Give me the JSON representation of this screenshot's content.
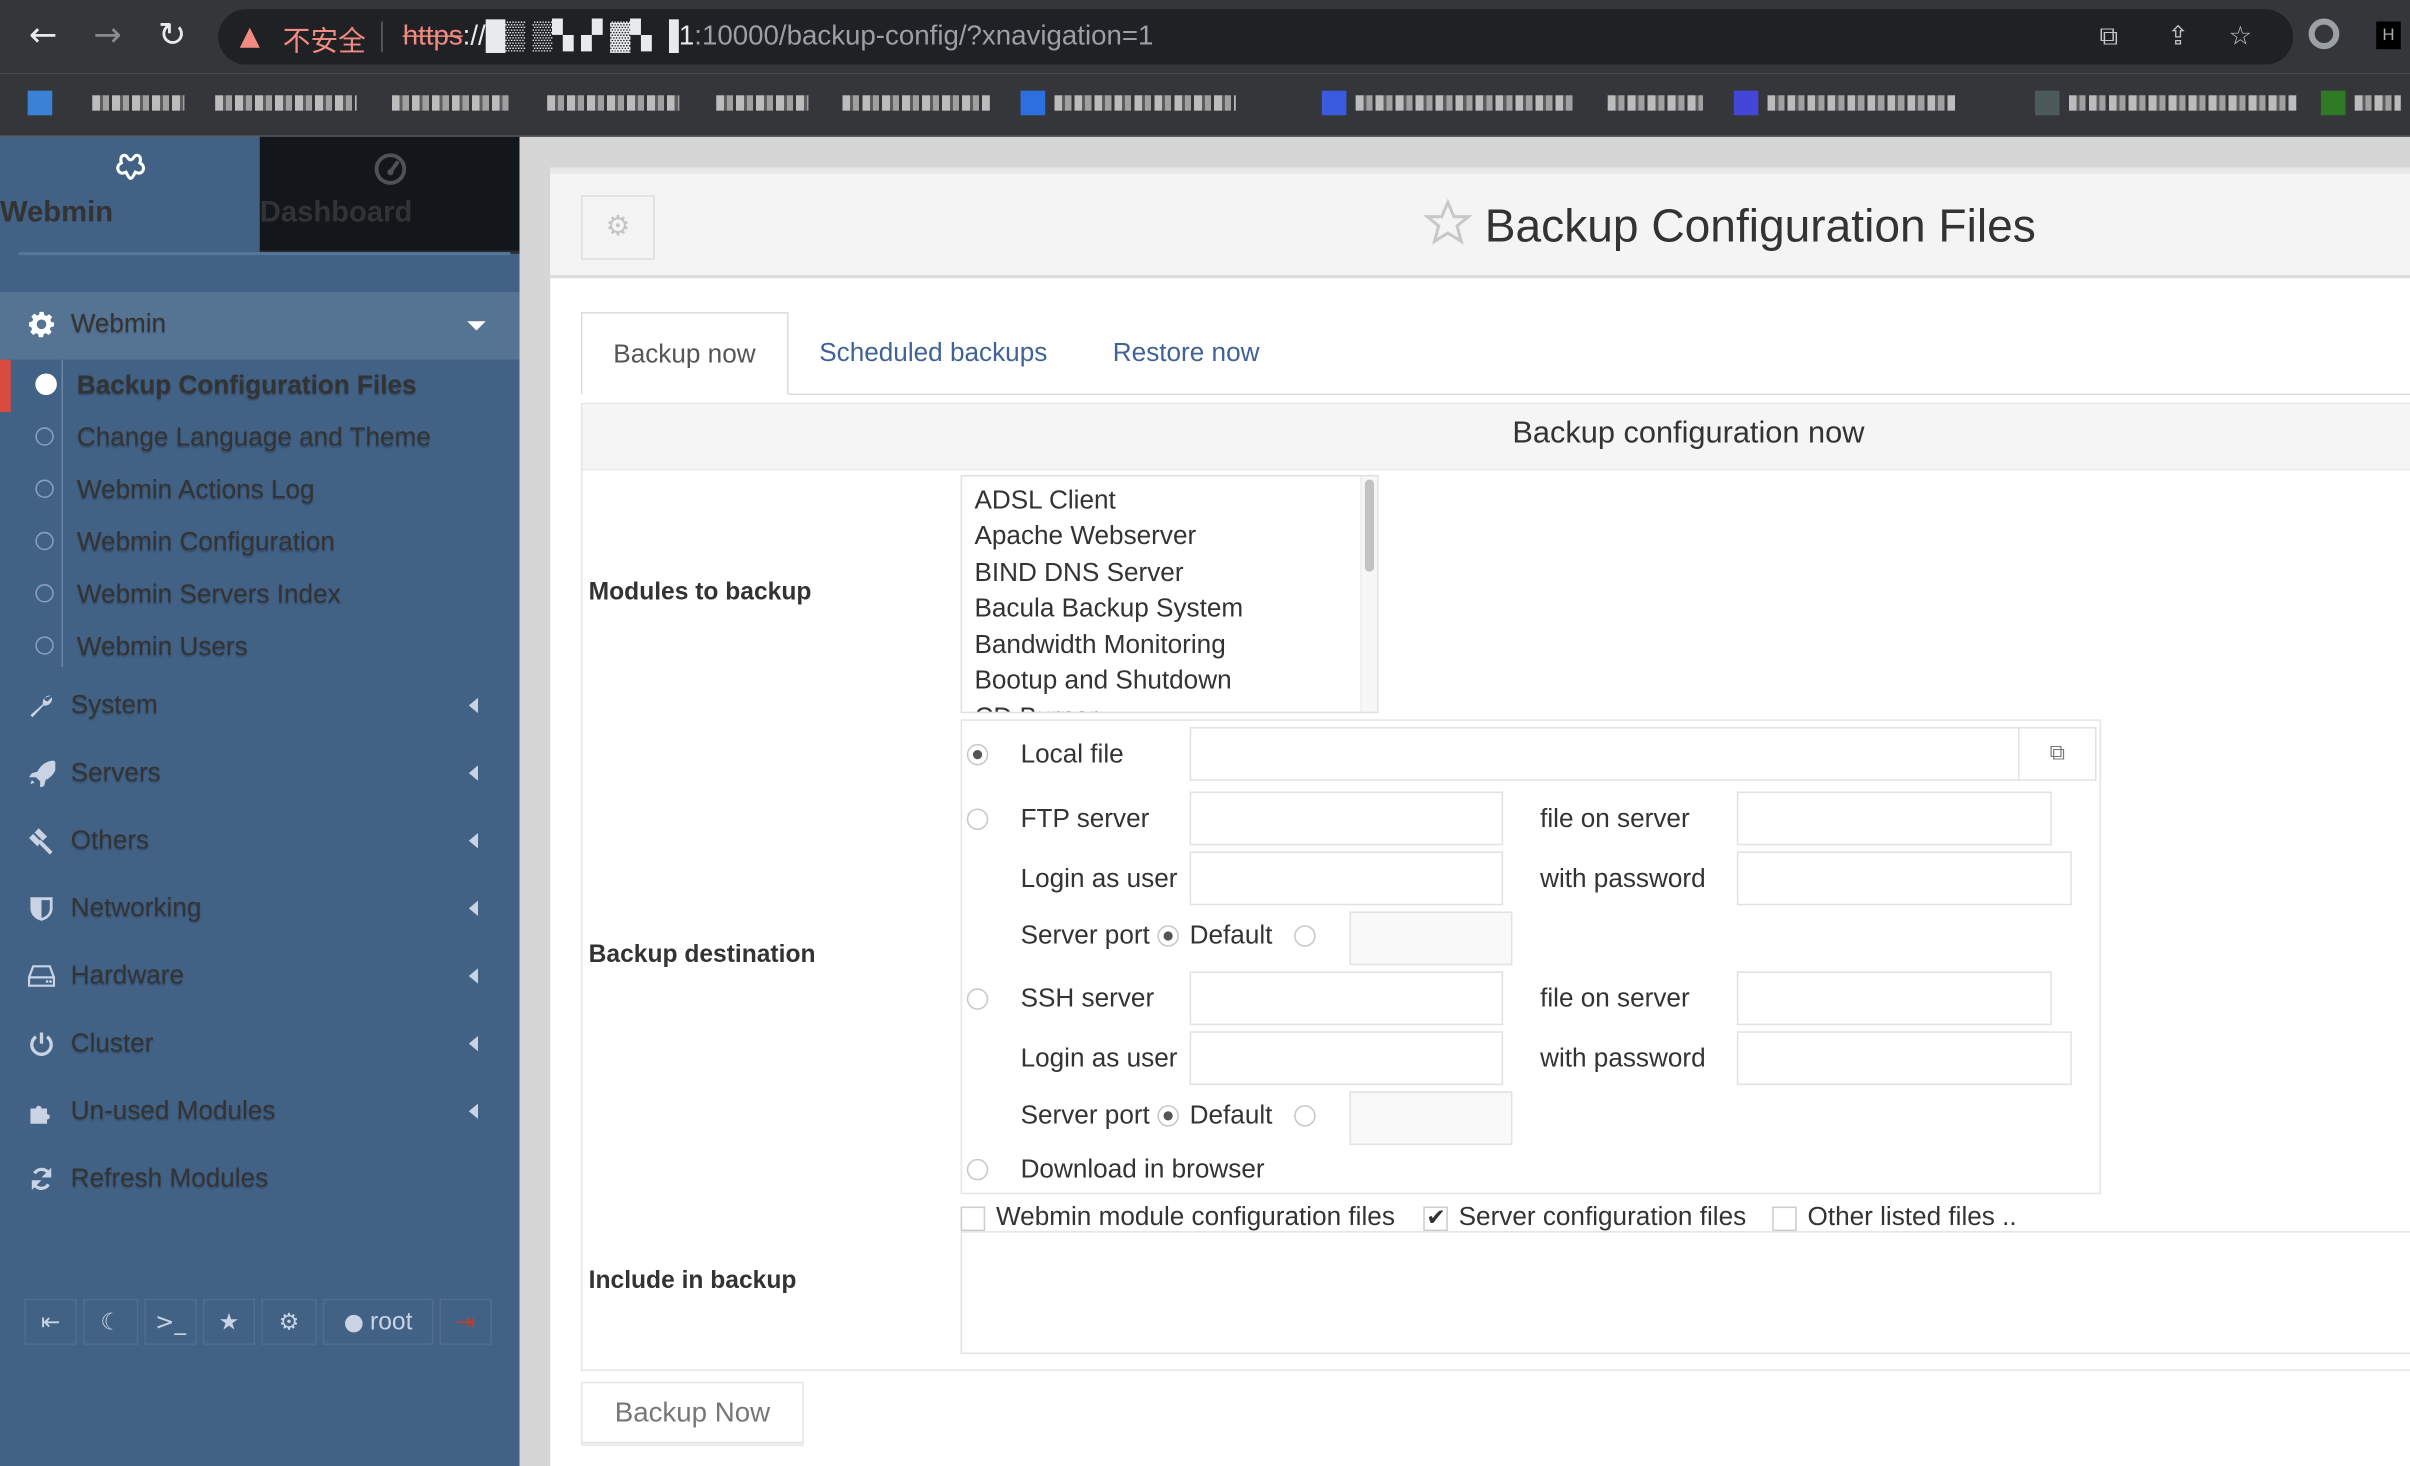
{
  "browser": {
    "nav": {
      "back_icon": "←",
      "forward_icon": "→",
      "reload_icon": "↻"
    },
    "omnibox": {
      "warning_icon": "▲",
      "security_label": "不安全",
      "url_scheme": "https",
      "url_host_obscured": "://█▒ ▒▚ ▞ ▓▚ ▐1",
      "url_rest": ":10000/backup-config/?xnavigation=1"
    },
    "icons": {
      "translate": "⧉",
      "share": "⇪",
      "bookmark": "☆"
    }
  },
  "sidebar": {
    "tabs": [
      {
        "label": "Webmin",
        "icon": "webmin-logo-icon"
      },
      {
        "label": "Dashboard",
        "icon": "dashboard-gauge-icon"
      }
    ],
    "open_section": {
      "label": "Webmin",
      "icon": "gear-icon"
    },
    "sub_items": [
      {
        "label": "Backup Configuration Files",
        "active": true
      },
      {
        "label": "Change Language and Theme"
      },
      {
        "label": "Webmin Actions Log"
      },
      {
        "label": "Webmin Configuration"
      },
      {
        "label": "Webmin Servers Index"
      },
      {
        "label": "Webmin Users"
      }
    ],
    "sections": [
      {
        "label": "System",
        "icon": "wrench-icon"
      },
      {
        "label": "Servers",
        "icon": "rocket-icon"
      },
      {
        "label": "Others",
        "icon": "gavel-icon"
      },
      {
        "label": "Networking",
        "icon": "shield-icon"
      },
      {
        "label": "Hardware",
        "icon": "hdd-icon"
      },
      {
        "label": "Cluster",
        "icon": "power-icon"
      },
      {
        "label": "Un-used Modules",
        "icon": "puzzle-icon"
      },
      {
        "label": "Refresh Modules",
        "icon": "refresh-icon"
      }
    ],
    "toolbar": {
      "collapse_icon": "⇤",
      "night_mode_icon": "☾",
      "terminal_icon": ">_",
      "favorites_icon": "★",
      "settings_icon": "⚙",
      "user_label": "root",
      "logout_icon": "⇥"
    }
  },
  "main": {
    "title": "Backup Configuration Files",
    "tabs": [
      {
        "label": "Backup now",
        "active": true
      },
      {
        "label": "Scheduled backups"
      },
      {
        "label": "Restore now"
      }
    ],
    "panel_title": "Backup configuration now",
    "modules": {
      "label": "Modules to backup",
      "options": [
        "ADSL Client",
        "Apache Webserver",
        "BIND DNS Server",
        "Bacula Backup System",
        "Bandwidth Monitoring",
        "Bootup and Shutdown",
        "CD Burner"
      ]
    },
    "destination": {
      "label": "Backup destination",
      "local_file_label": "Local file",
      "local_file_value": "",
      "ftp_label": "FTP server",
      "ssh_label": "SSH server",
      "file_on_server_label": "file on server",
      "login_label": "Login as user",
      "password_label": "with password",
      "server_port_label": "Server port",
      "default_label": "Default",
      "download_label": "Download in browser",
      "selected": "Local file"
    },
    "include": {
      "label": "Include in backup",
      "options": [
        {
          "label": "Webmin module configuration files",
          "checked": false
        },
        {
          "label": "Server configuration files",
          "checked": true
        },
        {
          "label": "Other listed files ..",
          "checked": false
        }
      ],
      "other_files_value": ""
    },
    "backup_button": "Backup Now"
  }
}
